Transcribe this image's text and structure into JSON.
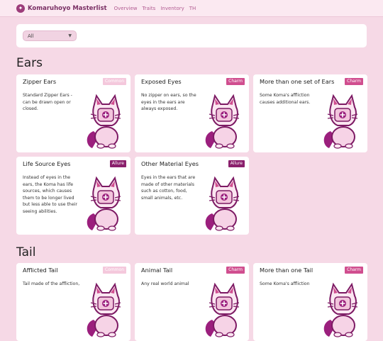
{
  "header": {
    "logo_icon": "sparkle-icon",
    "title": "Komaruhoyo Masterlist",
    "nav": [
      "Overview",
      "Traits",
      "Inventory",
      "TH"
    ]
  },
  "filter": {
    "selected": "All"
  },
  "colors": {
    "background": "#f6d9e6",
    "common": "#f4c8dc",
    "charm": "#d04e8f",
    "allure": "#8a1f6c",
    "accent": "#9c3c7a"
  },
  "sections": [
    {
      "title": "Ears",
      "cards": [
        {
          "title": "Zipper Ears",
          "badge": "Common",
          "desc": "Standard Zipper Ears - can be drawn open or closed."
        },
        {
          "title": "Exposed Eyes",
          "badge": "Charm",
          "desc": "No zipper on ears, so the eyes in the ears are always exposed."
        },
        {
          "title": "More than one set of Ears",
          "badge": "Charm",
          "desc": "Some Koma's affliction causes additional ears."
        },
        {
          "title": "Life Source Eyes",
          "badge": "Allure",
          "desc": "Instead of eyes in the ears, the Koma has life sources, which causes them to be longer lived but less able to use their seeing abilities."
        },
        {
          "title": "Other Material Eyes",
          "badge": "Allure",
          "desc": "Eyes in the ears that are made of other materials such as cotton, food, small animals, etc."
        }
      ]
    },
    {
      "title": "Tail",
      "cards": [
        {
          "title": "Afflicted Tail",
          "badge": "Common",
          "desc": "Tail made of the affliction,"
        },
        {
          "title": "Animal Tail",
          "badge": "Charm",
          "desc": "Any real world animal"
        },
        {
          "title": "More than one Tail",
          "badge": "Charm",
          "desc": "Some Koma's affliction"
        }
      ]
    }
  ]
}
